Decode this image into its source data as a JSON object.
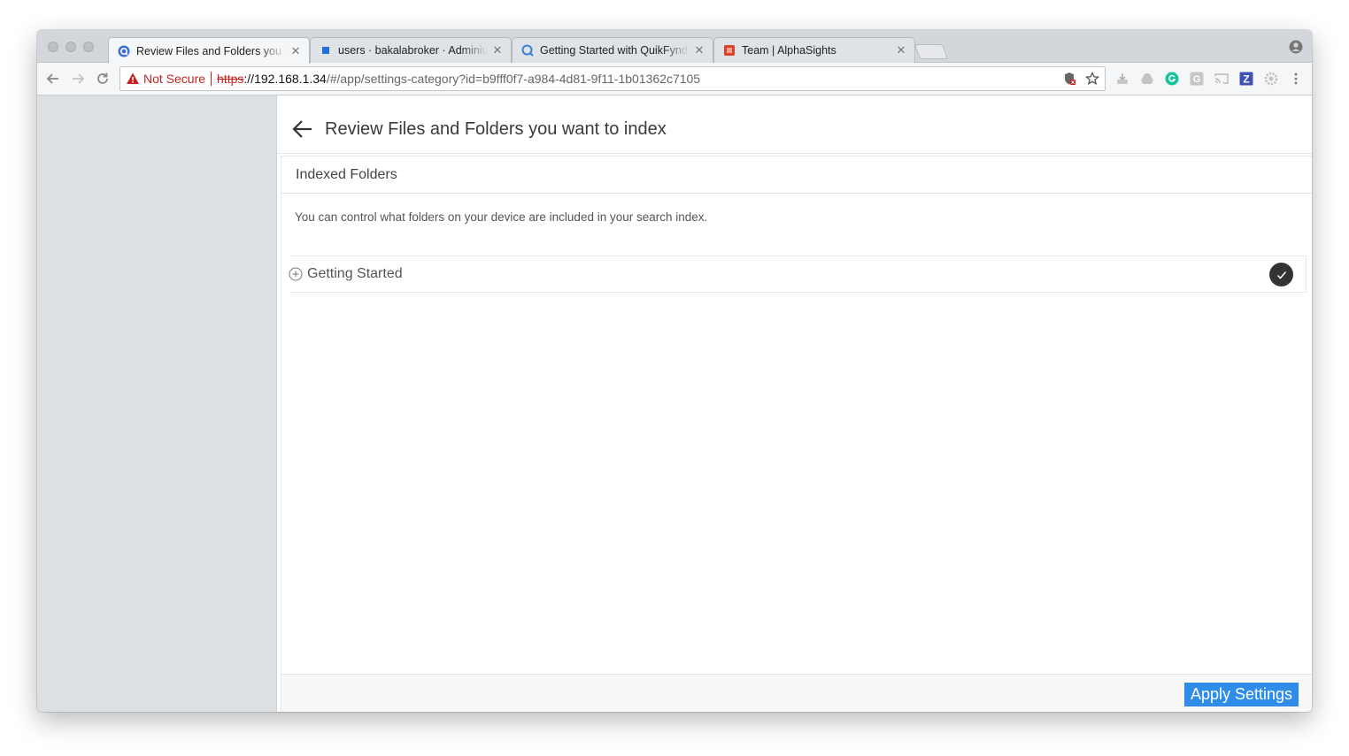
{
  "browser": {
    "tabs": [
      {
        "title": "Review Files and Folders you want to index",
        "icon": "quikfynd-icon",
        "active": true
      },
      {
        "title": "users · bakalabroker · Adminium",
        "icon": "adminium-icon",
        "active": false
      },
      {
        "title": "Getting Started with QuikFynd",
        "icon": "quikfynd-icon",
        "active": false
      },
      {
        "title": "Team | AlphaSights",
        "icon": "alphasights-icon",
        "active": false
      }
    ],
    "tab_close_glyph": "✕",
    "security_label": "Not Secure",
    "url": {
      "scheme": "https",
      "host": "://192.168.1.34",
      "path": "/#/app/settings-category?id=b9fff0f7-a984-4d81-9f11-1b01362c7105"
    },
    "extensions": [
      "ext-download-icon",
      "drive-icon",
      "grammarly-icon",
      "g-extension-icon",
      "cast-icon",
      "z-extension-icon",
      "settings-extension-icon",
      "menu-icon"
    ],
    "extension_letters": {
      "g": "G",
      "z": "Z"
    }
  },
  "page": {
    "title": "Review Files and Folders you want to index",
    "section_title": "Indexed Folders",
    "description": "You can control what folders on your device are included in your search index.",
    "folders": [
      {
        "label": "Getting Started",
        "checked": true
      }
    ],
    "apply_label": "Apply Settings"
  },
  "colors": {
    "accent": "#2f8ce8",
    "warning": "#c5221f",
    "sidebar": "#dde0e3"
  }
}
